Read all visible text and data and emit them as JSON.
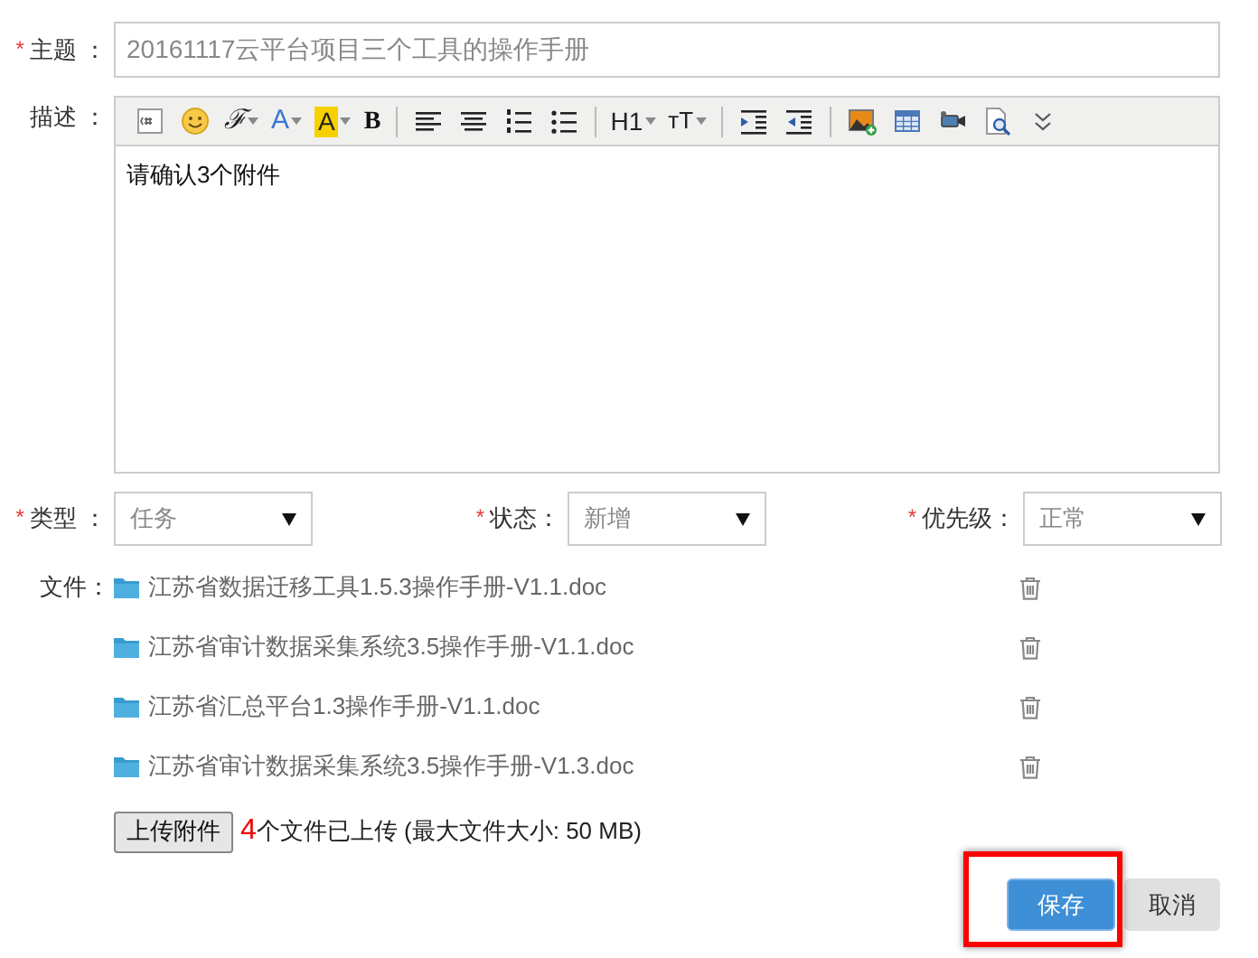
{
  "subject": {
    "label": "主题 ：",
    "mark": "*",
    "value": "20161117云平台项目三个工具的操作手册"
  },
  "description": {
    "label": "描述 ：",
    "toolbar": [
      {
        "kind": "code"
      },
      {
        "kind": "emoji"
      },
      {
        "kind": "font",
        "label": "ℱ",
        "dropdown": true
      },
      {
        "kind": "color",
        "label": "A",
        "dropdown": true
      },
      {
        "kind": "highlight",
        "label": "A",
        "dropdown": true
      },
      {
        "kind": "bold",
        "label": "B",
        "dropdown": false
      },
      {
        "kind": "separator"
      },
      {
        "kind": "align-left"
      },
      {
        "kind": "align-center"
      },
      {
        "kind": "ordered-list"
      },
      {
        "kind": "bullet-list"
      },
      {
        "kind": "separator"
      },
      {
        "kind": "heading",
        "label": "H1",
        "dropdown": true
      },
      {
        "kind": "size",
        "label": "ᴛT",
        "dropdown": true
      },
      {
        "kind": "separator"
      },
      {
        "kind": "indent"
      },
      {
        "kind": "outdent"
      },
      {
        "kind": "separator"
      },
      {
        "kind": "image"
      },
      {
        "kind": "table"
      },
      {
        "kind": "video"
      },
      {
        "kind": "preview"
      },
      {
        "kind": "more"
      }
    ],
    "content": "请确认3个附件"
  },
  "selects": [
    {
      "label": "类型 ：",
      "mark": "*",
      "value": "任务"
    },
    {
      "label": "状态：",
      "mark": "*",
      "value": "新增"
    },
    {
      "label": "优先级：",
      "mark": "*",
      "value": "正常"
    }
  ],
  "files": {
    "label": "文件：",
    "items": [
      {
        "name": "江苏省数据迁移工具1.5.3操作手册-V1.1.doc"
      },
      {
        "name": "江苏省审计数据采集系统3.5操作手册-V1.1.doc"
      },
      {
        "name": "江苏省汇总平台1.3操作手册-V1.1.doc"
      },
      {
        "name": "江苏省审计数据采集系统3.5操作手册-V1.3.doc"
      }
    ]
  },
  "upload": {
    "button": "上传附件",
    "count": "4",
    "status": "个文件已上传 (最大文件大小: 50 MB)"
  },
  "buttons": [
    {
      "label": "保存",
      "kind": "primary",
      "highlighted": true
    },
    {
      "label": "取消",
      "kind": "secondary",
      "highlighted": false
    }
  ]
}
